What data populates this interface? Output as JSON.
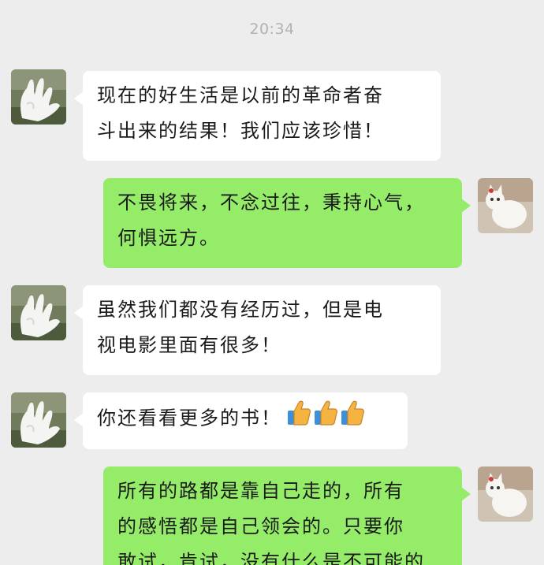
{
  "timestamp": "20:34",
  "messages": [
    {
      "side": "left",
      "lines": [
        "现在的好生活是以前的革命者奋",
        "斗出来的结果！我们应该珍惜！"
      ]
    },
    {
      "side": "right",
      "lines": [
        "不畏将来，不念过往，秉持心气，",
        "何惧远方。"
      ]
    },
    {
      "side": "left",
      "lines": [
        "虽然我们都没有经历过，但是电",
        "视电影里面有很多！"
      ]
    },
    {
      "side": "left",
      "lines": [
        "你还看看更多的书！"
      ],
      "emoji": [
        "thumbs-up-icon",
        "thumbs-up-icon",
        "thumbs-up-icon"
      ]
    },
    {
      "side": "right",
      "lines": [
        "所有的路都是靠自己走的，所有",
        "的感悟都是自己领会的。只要你",
        "敢试，肯试，没有什么是不可能的"
      ]
    }
  ],
  "colors": {
    "background": "#ededed",
    "left_bubble": "#ffffff",
    "right_bubble": "#95ec69",
    "timestamp": "#b2b2b2"
  }
}
